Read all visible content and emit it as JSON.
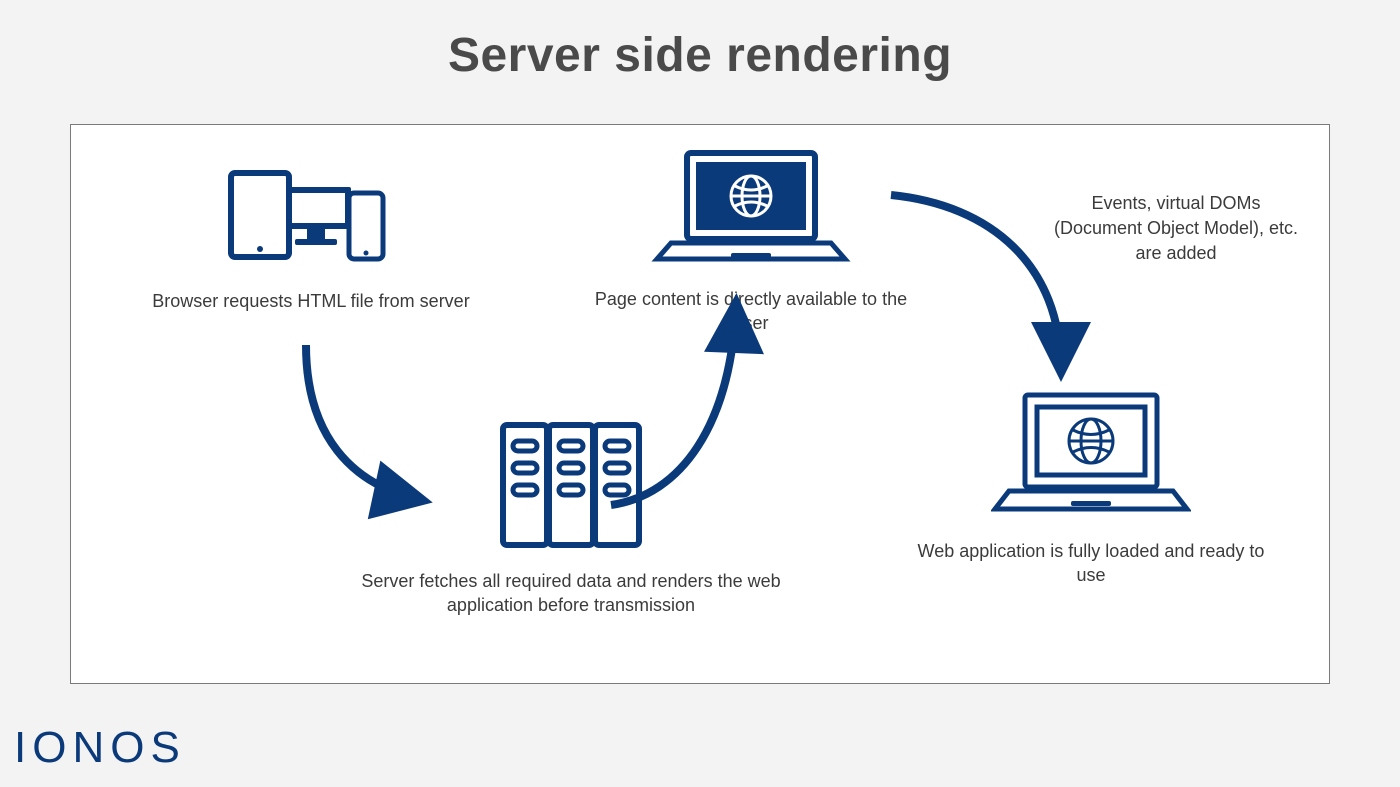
{
  "title": "Server side rendering",
  "nodes": {
    "browser": {
      "caption": "Browser requests HTML file from server"
    },
    "server": {
      "caption": "Server fetches all required data and renders the web application before transmission"
    },
    "page": {
      "caption": "Page content is directly available to the user"
    },
    "app": {
      "caption": "Web application is fully loaded and ready to use"
    }
  },
  "arrow_labels": {
    "events": "Events, virtual DOMs (Document Object Model), etc. are added"
  },
  "brand": "IONOS",
  "colors": {
    "ink": "#0b3a7a",
    "bg": "#f3f3f3",
    "panel": "#ffffff",
    "text": "#3b3b3b"
  }
}
